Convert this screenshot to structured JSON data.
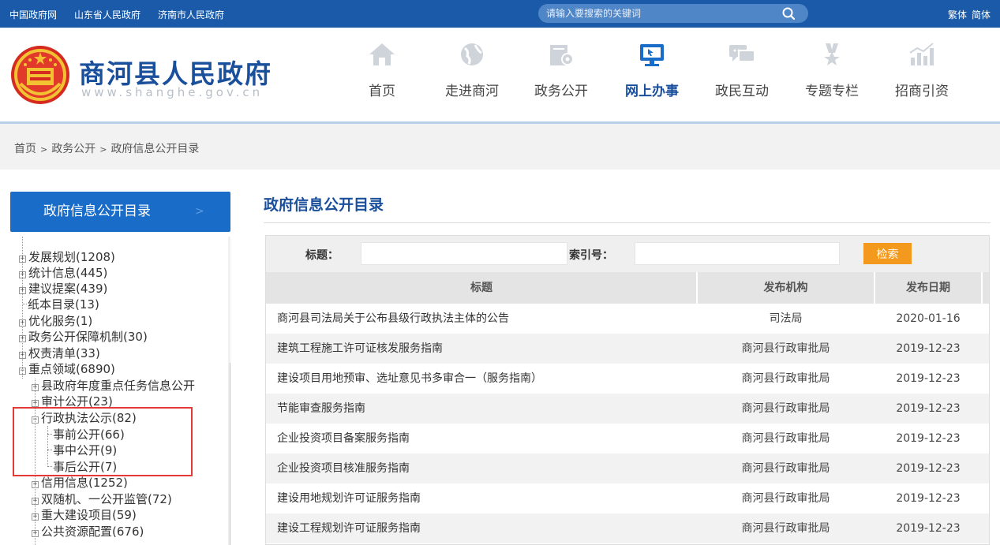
{
  "topbar": {
    "links": [
      "中国政府网",
      "山东省人民政府",
      "济南市人民政府"
    ],
    "search_placeholder": "请输入要搜索的关键词",
    "lang_traditional": "繁体",
    "lang_simplified": "简体"
  },
  "header": {
    "site_title": "商河县人民政府",
    "site_url": "www.shanghe.gov.cn",
    "nav": [
      {
        "label": "首页",
        "icon": "home-icon"
      },
      {
        "label": "走进商河",
        "icon": "globe-icon"
      },
      {
        "label": "政务公开",
        "icon": "folder-gear-icon"
      },
      {
        "label": "网上办事",
        "icon": "monitor-icon"
      },
      {
        "label": "政民互动",
        "icon": "chat-icon"
      },
      {
        "label": "专题专栏",
        "icon": "medal-icon"
      },
      {
        "label": "招商引资",
        "icon": "chart-up-icon"
      }
    ],
    "active_nav": "网上办事"
  },
  "breadcrumb": [
    "首页",
    "政务公开",
    "政府信息公开目录"
  ],
  "sidebar": {
    "heading": "政府信息公开目录",
    "tree": [
      {
        "label": "发展规划(1208)",
        "type": "plus"
      },
      {
        "label": "统计信息(445)",
        "type": "plus"
      },
      {
        "label": "建议提案(439)",
        "type": "plus"
      },
      {
        "label": "纸本目录(13)",
        "type": "leaf"
      },
      {
        "label": "优化服务(1)",
        "type": "plus"
      },
      {
        "label": "政务公开保障机制(30)",
        "type": "plus"
      },
      {
        "label": "权责清单(33)",
        "type": "plus"
      },
      {
        "label": "重点领域(6890)",
        "type": "minus"
      },
      {
        "label": "县政府年度重点任务信息公开",
        "type": "plus"
      },
      {
        "label": "审计公开(23)",
        "type": "plus"
      },
      {
        "label": "行政执法公示(82)",
        "type": "minus"
      },
      {
        "label": "事前公开(66)",
        "type": "leaf"
      },
      {
        "label": "事中公开(9)",
        "type": "leaf"
      },
      {
        "label": "事后公开(7)",
        "type": "leaf"
      },
      {
        "label": "信用信息(1252)",
        "type": "plus"
      },
      {
        "label": "双随机、一公开监管(72)",
        "type": "plus"
      },
      {
        "label": "重大建设项目(59)",
        "type": "plus"
      },
      {
        "label": "公共资源配置(676)",
        "type": "plus"
      }
    ]
  },
  "main": {
    "title": "政府信息公开目录",
    "filter": {
      "title_label": "标题：",
      "index_label": "索引号：",
      "search_button": "检索"
    },
    "columns": [
      "标题",
      "发布机构",
      "发布日期"
    ],
    "rows": [
      {
        "title": "商河县司法局关于公布县级行政执法主体的公告",
        "org": "司法局",
        "date": "2020-01-16"
      },
      {
        "title": "建筑工程施工许可证核发服务指南",
        "org": "商河县行政审批局",
        "date": "2019-12-23"
      },
      {
        "title": "建设项目用地预审、选址意见书多审合一（服务指南）",
        "org": "商河县行政审批局",
        "date": "2019-12-23"
      },
      {
        "title": "节能审查服务指南",
        "org": "商河县行政审批局",
        "date": "2019-12-23"
      },
      {
        "title": "企业投资项目备案服务指南",
        "org": "商河县行政审批局",
        "date": "2019-12-23"
      },
      {
        "title": "企业投资项目核准服务指南",
        "org": "商河县行政审批局",
        "date": "2019-12-23"
      },
      {
        "title": "建设用地规划许可证服务指南",
        "org": "商河县行政审批局",
        "date": "2019-12-23"
      },
      {
        "title": "建设工程规划许可证服务指南",
        "org": "商河县行政审批局",
        "date": "2019-12-23"
      }
    ]
  },
  "colors": {
    "topbar": "#1a5aa8",
    "brand": "#1a4f9c",
    "sidebar_head": "#1a6cc9",
    "search_button": "#f39a1e",
    "highlight": "#e53935"
  }
}
